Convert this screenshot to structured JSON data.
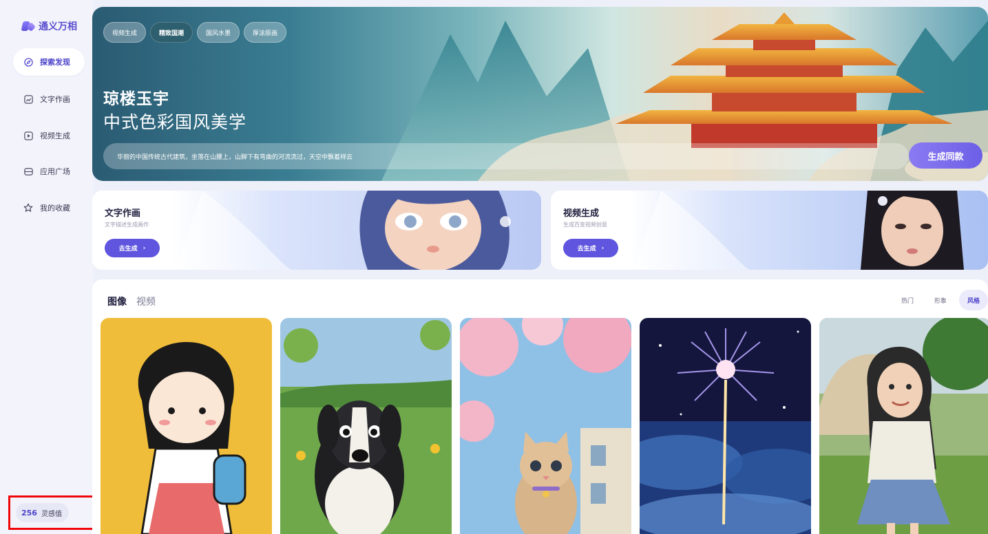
{
  "app": {
    "name": "通义万相"
  },
  "sidebar": {
    "items": [
      {
        "label": "探索发现",
        "icon": "compass-icon",
        "active": true
      },
      {
        "label": "文字作画",
        "icon": "image-edit-icon",
        "active": false
      },
      {
        "label": "视频生成",
        "icon": "play-square-icon",
        "active": false
      },
      {
        "label": "应用广场",
        "icon": "app-grid-icon",
        "active": false
      },
      {
        "label": "我的收藏",
        "icon": "star-icon",
        "active": false
      }
    ],
    "credits": {
      "value": "256",
      "label": "灵感值"
    }
  },
  "hero": {
    "chips": [
      {
        "label": "视频生成",
        "active": false
      },
      {
        "label": "精致国潮",
        "active": true
      },
      {
        "label": "国风水墨",
        "active": false
      },
      {
        "label": "厚涂原画",
        "active": false
      }
    ],
    "title": "琼楼玉宇",
    "subtitle": "中式色彩国风美学",
    "prompt": "华丽的中国传统古代建筑，坐落在山腰上，山脚下有弯曲的河流流过，天空中飘着祥云",
    "generate_label": "生成同款"
  },
  "cards": [
    {
      "title": "文字作画",
      "desc": "文字描述生成画作",
      "button": "去生成",
      "arrow": "›"
    },
    {
      "title": "视频生成",
      "desc": "生成百变视频创意",
      "button": "去生成",
      "arrow": "›"
    }
  ],
  "gallery": {
    "tabs": [
      {
        "label": "图像",
        "active": true
      },
      {
        "label": "视频",
        "active": false
      }
    ],
    "filters": [
      {
        "label": "热门",
        "active": false
      },
      {
        "label": "形象",
        "active": false
      },
      {
        "label": "风格",
        "active": true
      }
    ]
  },
  "colors": {
    "accent": "#5f55de",
    "highlight_border": "#f0060a",
    "sidebar_bg": "#f3f4fb"
  }
}
